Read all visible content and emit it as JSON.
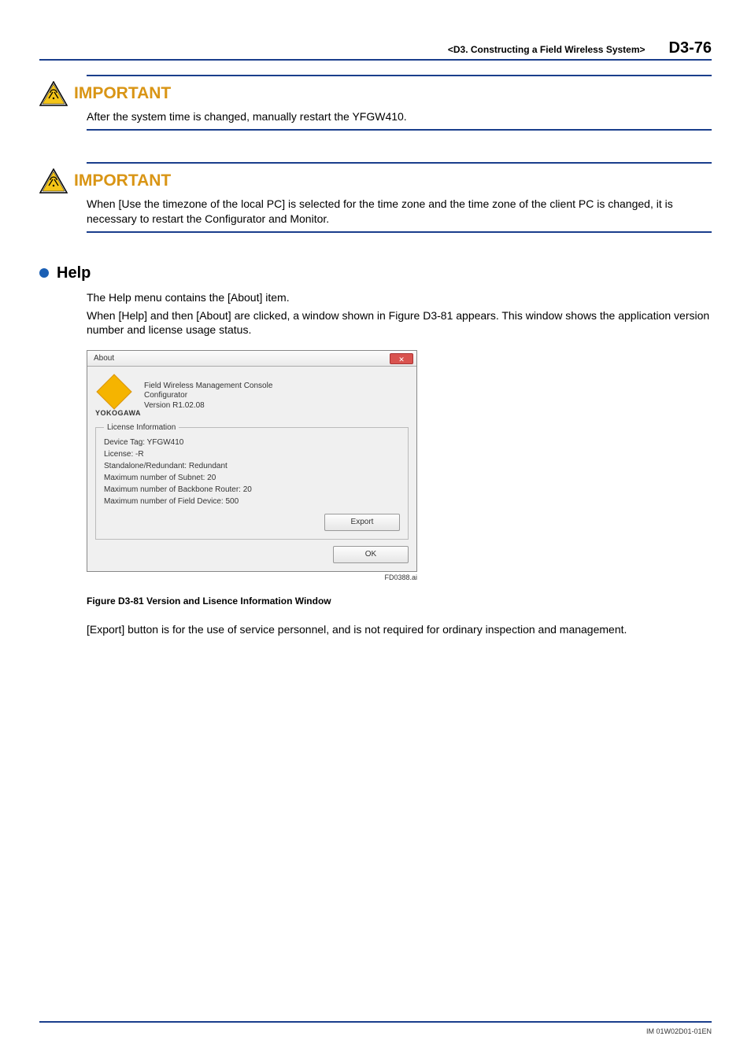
{
  "header": {
    "section": "<D3.  Constructing a Field Wireless System>",
    "page": "D3-76"
  },
  "important1": {
    "title": "IMPORTANT",
    "text": "After the system time is changed, manually restart the YFGW410."
  },
  "important2": {
    "title": "IMPORTANT",
    "text": "When [Use the timezone of the local PC] is selected for the time zone and the time zone of the client PC is changed, it is necessary to restart the Configurator and Monitor."
  },
  "help": {
    "title": "Help",
    "p1": "The Help menu contains the [About] item.",
    "p2": "When [Help] and then [About] are clicked, a window shown in Figure D3-81 appears. This window shows the application version number and license usage status."
  },
  "dialog": {
    "title": "About",
    "app_line1": "Field Wireless Management Console",
    "app_line2": "Configurator",
    "app_line3": "Version R1.02.08",
    "brand": "YOKOGAWA",
    "legend": "License Information",
    "info": {
      "l1": "Device Tag: YFGW410",
      "l2": "License: -R",
      "l3": "Standalone/Redundant: Redundant",
      "l4": "Maximum number of Subnet: 20",
      "l5": "Maximum number of Backbone Router: 20",
      "l6": "Maximum number of Field Device: 500"
    },
    "buttons": {
      "export": "Export",
      "ok": "OK"
    },
    "figid": "FD0388.ai"
  },
  "figure_caption": "Figure D3-81  Version and Lisence Information Window",
  "export_note": "[Export] button is for the use of service personnel, and is not required for ordinary inspection and management.",
  "footer": "IM 01W02D01-01EN"
}
